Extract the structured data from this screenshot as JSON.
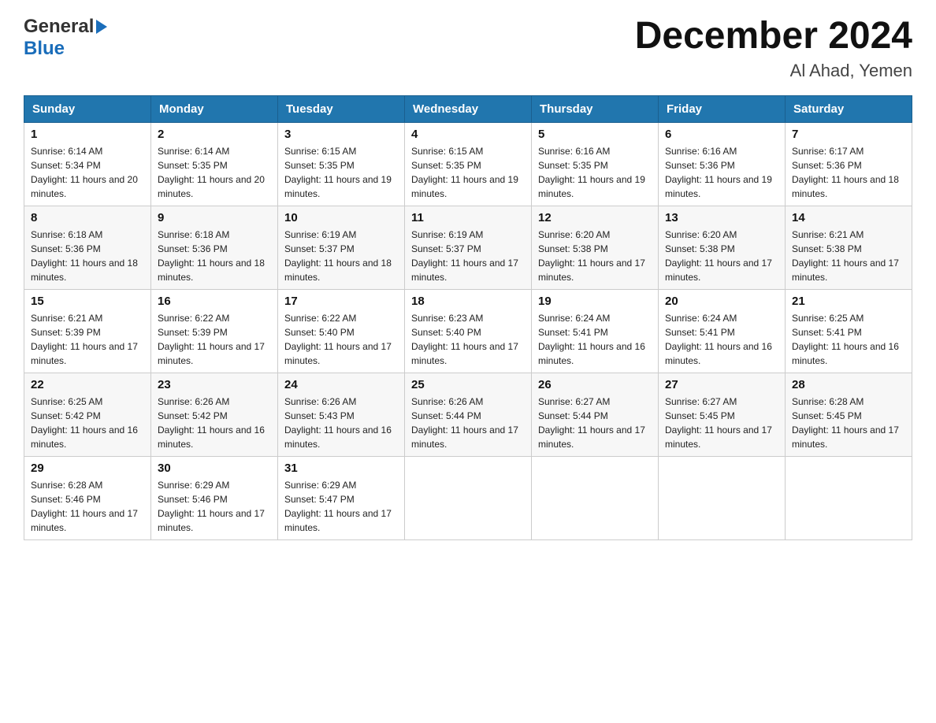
{
  "header": {
    "logo_general": "General",
    "logo_blue": "Blue",
    "title": "December 2024",
    "subtitle": "Al Ahad, Yemen"
  },
  "days_of_week": [
    "Sunday",
    "Monday",
    "Tuesday",
    "Wednesday",
    "Thursday",
    "Friday",
    "Saturday"
  ],
  "weeks": [
    [
      {
        "day": "1",
        "sunrise": "6:14 AM",
        "sunset": "5:34 PM",
        "daylight": "11 hours and 20 minutes."
      },
      {
        "day": "2",
        "sunrise": "6:14 AM",
        "sunset": "5:35 PM",
        "daylight": "11 hours and 20 minutes."
      },
      {
        "day": "3",
        "sunrise": "6:15 AM",
        "sunset": "5:35 PM",
        "daylight": "11 hours and 19 minutes."
      },
      {
        "day": "4",
        "sunrise": "6:15 AM",
        "sunset": "5:35 PM",
        "daylight": "11 hours and 19 minutes."
      },
      {
        "day": "5",
        "sunrise": "6:16 AM",
        "sunset": "5:35 PM",
        "daylight": "11 hours and 19 minutes."
      },
      {
        "day": "6",
        "sunrise": "6:16 AM",
        "sunset": "5:36 PM",
        "daylight": "11 hours and 19 minutes."
      },
      {
        "day": "7",
        "sunrise": "6:17 AM",
        "sunset": "5:36 PM",
        "daylight": "11 hours and 18 minutes."
      }
    ],
    [
      {
        "day": "8",
        "sunrise": "6:18 AM",
        "sunset": "5:36 PM",
        "daylight": "11 hours and 18 minutes."
      },
      {
        "day": "9",
        "sunrise": "6:18 AM",
        "sunset": "5:36 PM",
        "daylight": "11 hours and 18 minutes."
      },
      {
        "day": "10",
        "sunrise": "6:19 AM",
        "sunset": "5:37 PM",
        "daylight": "11 hours and 18 minutes."
      },
      {
        "day": "11",
        "sunrise": "6:19 AM",
        "sunset": "5:37 PM",
        "daylight": "11 hours and 17 minutes."
      },
      {
        "day": "12",
        "sunrise": "6:20 AM",
        "sunset": "5:38 PM",
        "daylight": "11 hours and 17 minutes."
      },
      {
        "day": "13",
        "sunrise": "6:20 AM",
        "sunset": "5:38 PM",
        "daylight": "11 hours and 17 minutes."
      },
      {
        "day": "14",
        "sunrise": "6:21 AM",
        "sunset": "5:38 PM",
        "daylight": "11 hours and 17 minutes."
      }
    ],
    [
      {
        "day": "15",
        "sunrise": "6:21 AM",
        "sunset": "5:39 PM",
        "daylight": "11 hours and 17 minutes."
      },
      {
        "day": "16",
        "sunrise": "6:22 AM",
        "sunset": "5:39 PM",
        "daylight": "11 hours and 17 minutes."
      },
      {
        "day": "17",
        "sunrise": "6:22 AM",
        "sunset": "5:40 PM",
        "daylight": "11 hours and 17 minutes."
      },
      {
        "day": "18",
        "sunrise": "6:23 AM",
        "sunset": "5:40 PM",
        "daylight": "11 hours and 17 minutes."
      },
      {
        "day": "19",
        "sunrise": "6:24 AM",
        "sunset": "5:41 PM",
        "daylight": "11 hours and 16 minutes."
      },
      {
        "day": "20",
        "sunrise": "6:24 AM",
        "sunset": "5:41 PM",
        "daylight": "11 hours and 16 minutes."
      },
      {
        "day": "21",
        "sunrise": "6:25 AM",
        "sunset": "5:41 PM",
        "daylight": "11 hours and 16 minutes."
      }
    ],
    [
      {
        "day": "22",
        "sunrise": "6:25 AM",
        "sunset": "5:42 PM",
        "daylight": "11 hours and 16 minutes."
      },
      {
        "day": "23",
        "sunrise": "6:26 AM",
        "sunset": "5:42 PM",
        "daylight": "11 hours and 16 minutes."
      },
      {
        "day": "24",
        "sunrise": "6:26 AM",
        "sunset": "5:43 PM",
        "daylight": "11 hours and 16 minutes."
      },
      {
        "day": "25",
        "sunrise": "6:26 AM",
        "sunset": "5:44 PM",
        "daylight": "11 hours and 17 minutes."
      },
      {
        "day": "26",
        "sunrise": "6:27 AM",
        "sunset": "5:44 PM",
        "daylight": "11 hours and 17 minutes."
      },
      {
        "day": "27",
        "sunrise": "6:27 AM",
        "sunset": "5:45 PM",
        "daylight": "11 hours and 17 minutes."
      },
      {
        "day": "28",
        "sunrise": "6:28 AM",
        "sunset": "5:45 PM",
        "daylight": "11 hours and 17 minutes."
      }
    ],
    [
      {
        "day": "29",
        "sunrise": "6:28 AM",
        "sunset": "5:46 PM",
        "daylight": "11 hours and 17 minutes."
      },
      {
        "day": "30",
        "sunrise": "6:29 AM",
        "sunset": "5:46 PM",
        "daylight": "11 hours and 17 minutes."
      },
      {
        "day": "31",
        "sunrise": "6:29 AM",
        "sunset": "5:47 PM",
        "daylight": "11 hours and 17 minutes."
      },
      null,
      null,
      null,
      null
    ]
  ],
  "labels": {
    "sunrise": "Sunrise:",
    "sunset": "Sunset:",
    "daylight": "Daylight:"
  }
}
